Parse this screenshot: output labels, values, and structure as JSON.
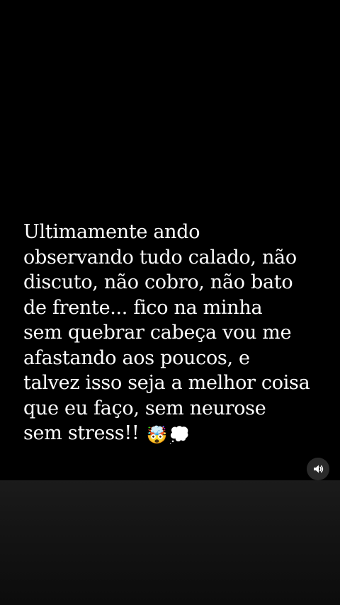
{
  "story": {
    "lines": [
      "Ultimamente ando",
      "observando tudo calado, não",
      "discuto, não cobro, não bato",
      "de frente... fico na minha",
      "sem quebrar cabeça vou me",
      "afastando aos poucos, e",
      "talvez isso seja a melhor coisa",
      "que eu faço, sem neurose",
      "sem stress!!"
    ],
    "emojis": [
      "🤯",
      "💭"
    ]
  },
  "controls": {
    "sound_icon": "speaker-on-icon"
  },
  "colors": {
    "background": "#000000",
    "text": "#ffffff",
    "sound_button_bg": "#2a2a2a"
  }
}
